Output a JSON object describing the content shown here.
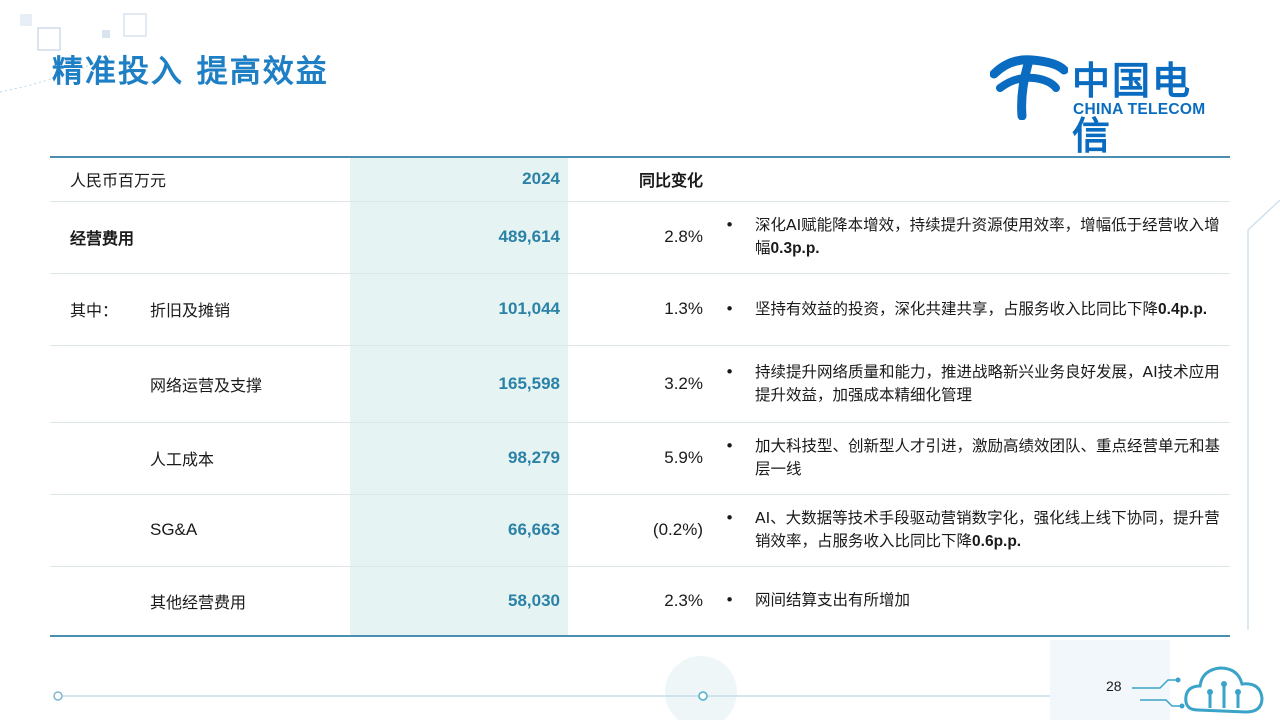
{
  "title": "精准投入 提高效益",
  "logo": {
    "cn": "中国电信",
    "en": "CHINA TELECOM"
  },
  "table": {
    "headers": {
      "unit": "人民币百万元",
      "year": "2024",
      "yoy": "同比变化"
    },
    "rows": [
      {
        "prefix": "",
        "label": "经营费用",
        "value": "489,614",
        "yoy": "2.8%",
        "comment": {
          "parts": [
            {
              "t": "深化AI赋能降本增效，持续提升资源使用效率，增幅低于经营收入增幅"
            },
            {
              "t": "0.3p.p.",
              "b": true
            }
          ]
        }
      },
      {
        "prefix": "其中：",
        "label": "折旧及摊销",
        "value": "101,044",
        "yoy": "1.3%",
        "comment": {
          "parts": [
            {
              "t": "坚持有效益的投资，深化共建共享，占服务收入比同比下降"
            },
            {
              "t": "0.4p.p.",
              "b": true
            }
          ]
        }
      },
      {
        "prefix": "",
        "label": "网络运营及支撑",
        "value": "165,598",
        "yoy": "3.2%",
        "comment": {
          "parts": [
            {
              "t": "持续提升网络质量和能力，推进战略新兴业务良好发展，AI技术应用提升效益，加强成本精细化管理"
            }
          ]
        }
      },
      {
        "prefix": "",
        "label": "人工成本",
        "value": "98,279",
        "yoy": "5.9%",
        "comment": {
          "parts": [
            {
              "t": "加大科技型、创新型人才引进，激励高绩效团队、重点经营单元和基层一线"
            }
          ]
        }
      },
      {
        "prefix": "",
        "label": "SG&A",
        "value": "66,663",
        "yoy": "(0.2%)",
        "comment": {
          "parts": [
            {
              "t": "AI、大数据等技术手段驱动营销数字化，强化线上线下协同，提升营销效率，占服务收入比同比下降"
            },
            {
              "t": "0.6p.p.",
              "b": true
            }
          ]
        }
      },
      {
        "prefix": "",
        "label": "其他经营费用",
        "value": "58,030",
        "yoy": "2.3%",
        "comment": {
          "parts": [
            {
              "t": "网间结算支出有所增加"
            }
          ]
        }
      }
    ]
  },
  "bullet_symbol": "•",
  "page_number": "28",
  "colors": {
    "title": "#1e7fc4",
    "accent": "#2b82a6",
    "value_bg": "#e5f3f3",
    "rule": "#4a8fb2"
  }
}
